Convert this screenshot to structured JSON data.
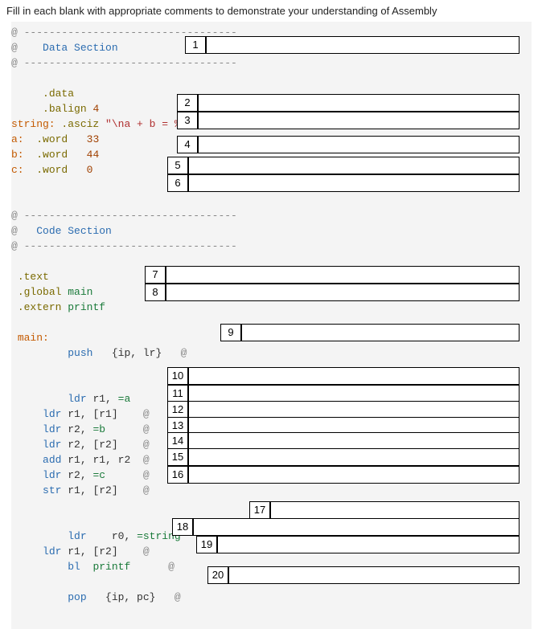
{
  "instruction": "Fill in each blank with appropriate comments to demonstrate your understanding of Assembly",
  "section1": "Data Section",
  "section2": "Code Section",
  "dashes": "----------------------------------",
  "data_dir": ".data",
  "balign": ".balign",
  "balign_n": "4",
  "string_lbl": "string:",
  "asciz": ".asciz",
  "asciz_val": "\"\\na + b = %d\\n\"",
  "a_lbl": "a:",
  "b_lbl": "b:",
  "c_lbl": "c:",
  "word": ".word",
  "n33": "33",
  "n44": "44",
  "n0": "0",
  "text_dir": ".text",
  "global": ".global",
  "extern": ".extern",
  "main_id": "main",
  "printf_id": "printf",
  "main_lbl": "main:",
  "push": "push",
  "push_args": "{ip, lr}",
  "ldr": "ldr",
  "add": "add",
  "str": "str",
  "bl": "bl",
  "pop": "pop",
  "r0": "r0,",
  "r1": "r1,",
  "r2": "r2,",
  "r1b": "[r1]",
  "r2b": "[r2]",
  "eqa": "=a",
  "eqb": "=b",
  "eqc": "=c",
  "addargs": "r1, r1, r2",
  "eqstring": "=string",
  "pop_args": "{ip, pc}",
  "blanks": {
    "1": "1",
    "2": "2",
    "3": "3",
    "4": "4",
    "5": "5",
    "6": "6",
    "7": "7",
    "8": "8",
    "9": "9",
    "10": "10",
    "11": "11",
    "12": "12",
    "13": "13",
    "14": "14",
    "15": "15",
    "16": "16",
    "17": "17",
    "18": "18",
    "19": "19",
    "20": "20"
  }
}
